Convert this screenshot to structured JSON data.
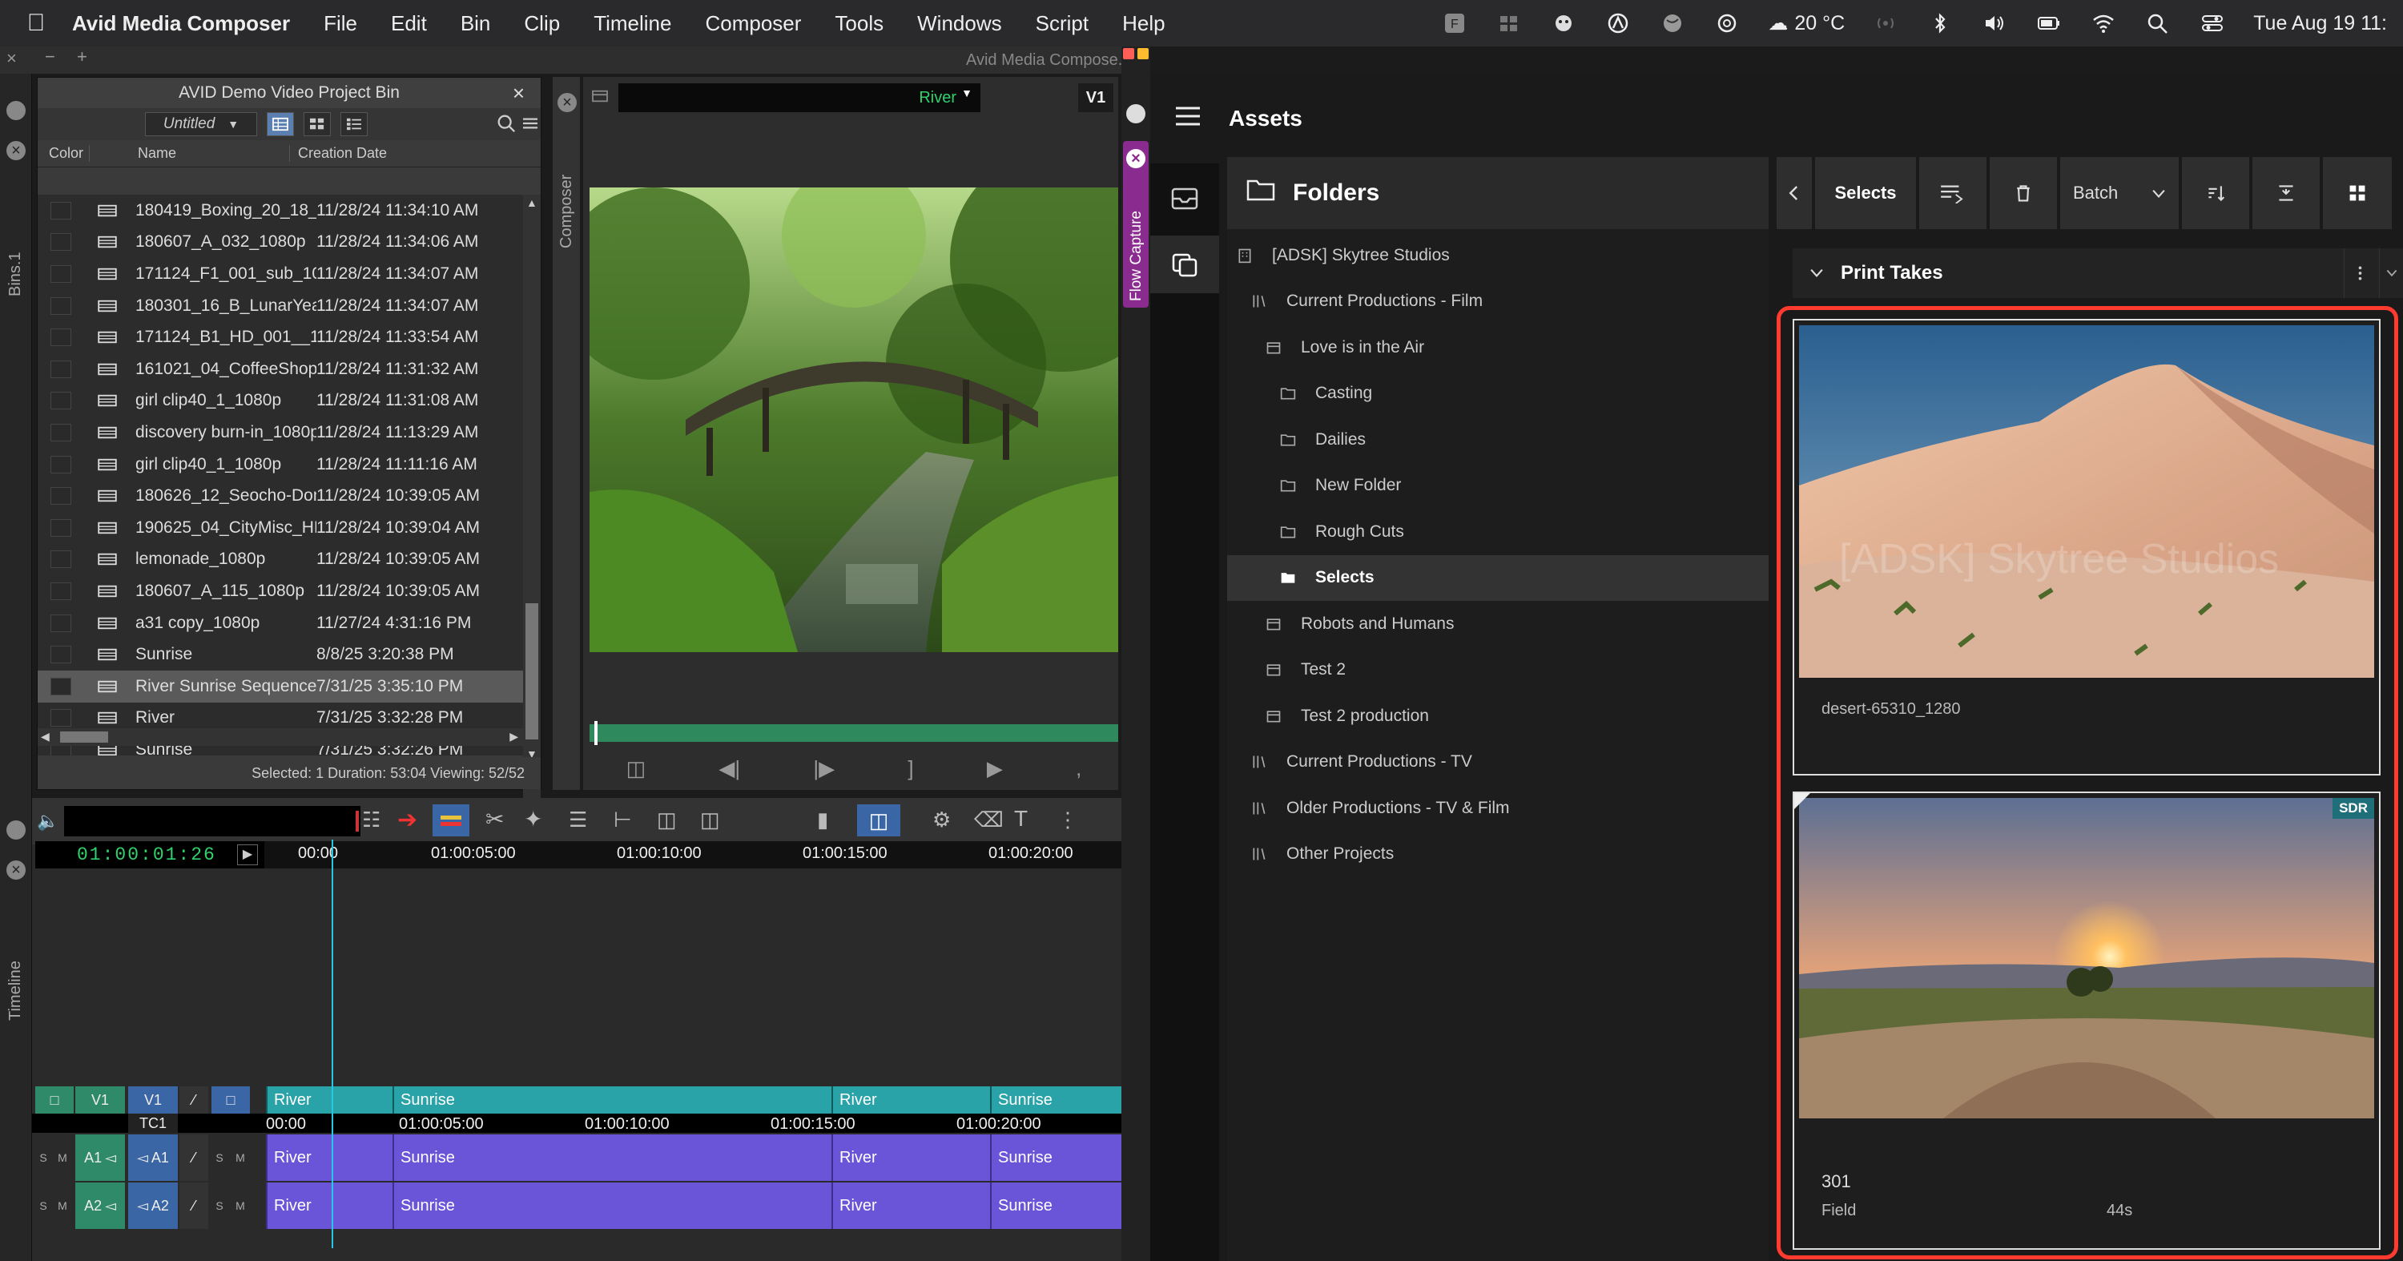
{
  "menubar": {
    "app": "Avid Media Composer",
    "items": [
      "File",
      "Edit",
      "Bin",
      "Clip",
      "Timeline",
      "Composer",
      "Tools",
      "Windows",
      "Script",
      "Help"
    ],
    "weather": "20 °C",
    "clock": "Tue Aug 19  11:"
  },
  "avid": {
    "window_title": "Avid Media Compose...",
    "bins_label": "Bins.1",
    "composer_label": "Composer",
    "timeline_label": "Timeline",
    "flow_capture_label": "Flow Capture"
  },
  "bin": {
    "title": "AVID Demo Video Project Bin",
    "view": "Untitled",
    "columns": {
      "color": "Color",
      "name": "Name",
      "date": "Creation Date"
    },
    "rows": [
      {
        "name": "180419_Boxing_20_18_1...",
        "date": "11/28/24 11:34:10 AM"
      },
      {
        "name": "180607_A_032_1080p",
        "date": "11/28/24 11:34:06 AM"
      },
      {
        "name": "171124_F1_001_sub_10...",
        "date": "11/28/24 11:34:07 AM"
      },
      {
        "name": "180301_16_B_LunarYear...",
        "date": "11/28/24 11:34:07 AM"
      },
      {
        "name": "171124_B1_HD_001__10...",
        "date": "11/28/24 11:33:54 AM"
      },
      {
        "name": "161021_04_CoffeeShop_...",
        "date": "11/28/24 11:31:32 AM"
      },
      {
        "name": "girl clip40_1_1080p",
        "date": "11/28/24 11:31:08 AM"
      },
      {
        "name": "discovery burn-in_1080p",
        "date": "11/28/24 11:13:29 AM"
      },
      {
        "name": "girl clip40_1_1080p",
        "date": "11/28/24 11:11:16 AM"
      },
      {
        "name": "180626_12_Seocho-Don...",
        "date": "11/28/24 10:39:05 AM"
      },
      {
        "name": "190625_04_CityMisc_HD...",
        "date": "11/28/24 10:39:04 AM"
      },
      {
        "name": "lemonade_1080p",
        "date": "11/28/24 10:39:05 AM"
      },
      {
        "name": "180607_A_115_1080p",
        "date": "11/28/24 10:39:05 AM"
      },
      {
        "name": "a31 copy_1080p",
        "date": "11/27/24 4:31:16 PM"
      },
      {
        "name": "Sunrise",
        "date": "8/8/25 3:20:38 PM"
      },
      {
        "name": "River Sunrise Sequence",
        "date": "7/31/25 3:35:10 PM"
      },
      {
        "name": "River",
        "date": "7/31/25 3:32:28 PM"
      },
      {
        "name": "Sunrise",
        "date": "7/31/25 3:32:26 PM"
      }
    ],
    "selected_index": 15,
    "status": "Selected: 1  Duration: 53:04   Viewing: 52/52"
  },
  "composer": {
    "clip": "River",
    "track": "V1"
  },
  "timeline": {
    "timecode": "01:00:01:26",
    "ruler": [
      "00:00",
      "01:00:05:00",
      "01:00:10:00",
      "01:00:15:00",
      "01:00:20:00"
    ],
    "track_labels": {
      "v1": "V1",
      "v1_rec": "V1",
      "tc1": "TC1",
      "a1": "A1",
      "a1_rec": "A1",
      "a2": "A2",
      "a2_rec": "A2",
      "s": "S",
      "m": "M"
    },
    "clips": [
      "River",
      "Sunrise",
      "River",
      "Sunrise"
    ]
  },
  "assets": {
    "title": "Assets",
    "folders_title": "Folders",
    "tree": [
      {
        "label": "[ADSK] Skytree Studios",
        "depth": 0,
        "icon": "building-icon"
      },
      {
        "label": "Current Productions - Film",
        "depth": 1,
        "icon": "library-icon"
      },
      {
        "label": "Love is in the Air",
        "depth": 2,
        "icon": "project-icon"
      },
      {
        "label": "Casting",
        "depth": 3,
        "icon": "folder-icon"
      },
      {
        "label": "Dailies",
        "depth": 3,
        "icon": "folder-icon"
      },
      {
        "label": "New Folder",
        "depth": 3,
        "icon": "folder-icon"
      },
      {
        "label": "Rough Cuts",
        "depth": 3,
        "icon": "folder-icon"
      },
      {
        "label": "Selects",
        "depth": 3,
        "icon": "folder-icon",
        "selected": true
      },
      {
        "label": "Robots and Humans",
        "depth": 2,
        "icon": "project-icon"
      },
      {
        "label": "Test 2",
        "depth": 2,
        "icon": "project-icon"
      },
      {
        "label": "Test 2 production",
        "depth": 2,
        "icon": "project-icon"
      },
      {
        "label": "Current Productions - TV",
        "depth": 1,
        "icon": "library-icon"
      },
      {
        "label": "Older Productions - TV & Film",
        "depth": 1,
        "icon": "library-icon"
      },
      {
        "label": "Other Projects",
        "depth": 1,
        "icon": "library-icon"
      }
    ],
    "toolbar": {
      "selects": "Selects",
      "batch": "Batch"
    },
    "group": "Print Takes",
    "cards": [
      {
        "name": "desert-65310_1280",
        "watermark": "[ADSK] Skytree Studios"
      },
      {
        "name": "301",
        "field_label": "Field",
        "duration": "44s",
        "badge": "SDR"
      }
    ]
  },
  "colors": {
    "accent_red": "#ff3b2f",
    "timecode_green": "#2fd26a",
    "playhead": "#25c6e6",
    "video_track": "#2aa3a8",
    "audio_track": "#6a55d8",
    "flow_purple": "#8a2b8f"
  }
}
